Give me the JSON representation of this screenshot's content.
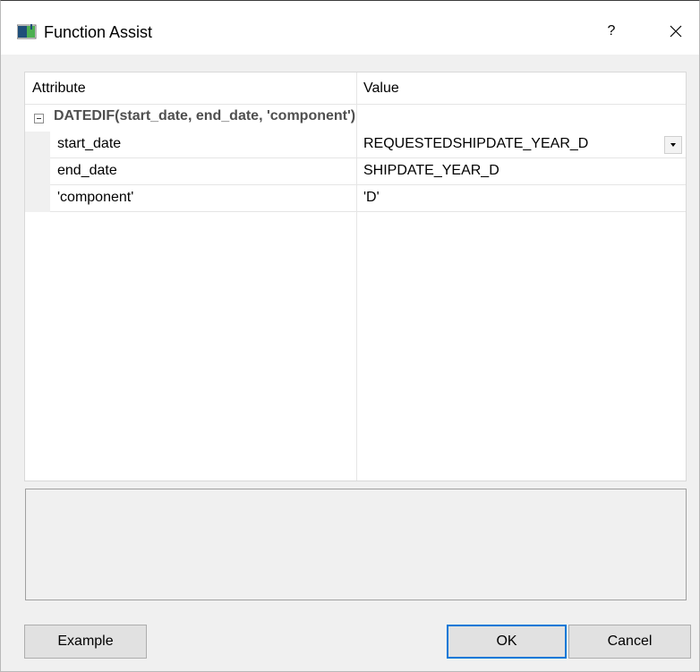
{
  "window": {
    "title": "Function Assist",
    "help_label": "?"
  },
  "tree": {
    "headers": {
      "attribute": "Attribute",
      "value": "Value"
    },
    "group": {
      "label": "DATEDIF(start_date, end_date, 'component')",
      "expanded": true
    },
    "rows": [
      {
        "name": "start_date",
        "value": "REQUESTEDSHIPDATE_YEAR_D",
        "has_dropdown": true
      },
      {
        "name": "end_date",
        "value": "SHIPDATE_YEAR_D"
      },
      {
        "name": "'component'",
        "value": "'D'"
      }
    ]
  },
  "description": "",
  "buttons": {
    "example": "Example",
    "ok": "OK",
    "cancel": "Cancel"
  },
  "colors": {
    "ok_focus_border": "#0078d7",
    "button_face": "#e1e1e1",
    "dialog_bg": "#f0f0f0"
  }
}
